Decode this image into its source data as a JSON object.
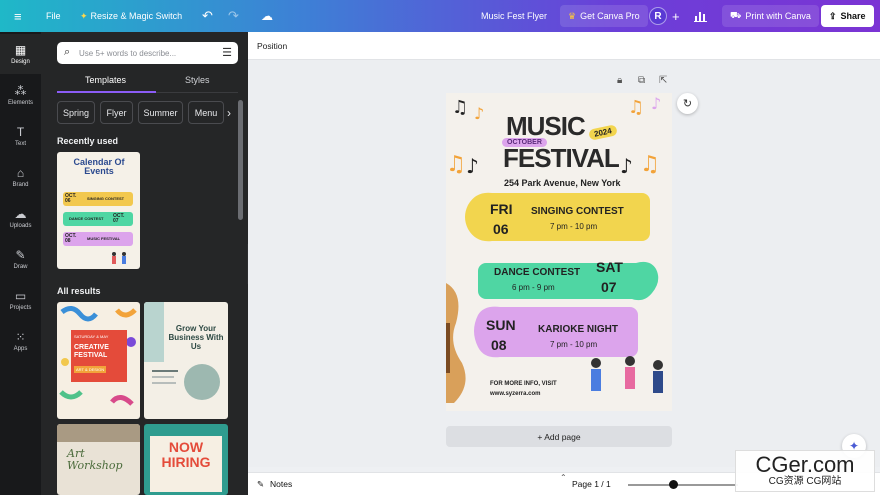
{
  "topbar": {
    "menu_icon": "hamburger-icon",
    "file_label": "File",
    "resize_label": "Resize & Magic Switch",
    "doc_title": "Music Fest Flyer",
    "get_pro_label": "Get Canva Pro",
    "avatar_letter": "R",
    "print_label": "Print with Canva",
    "share_label": "Share"
  },
  "rail": {
    "items": [
      {
        "label": "Design",
        "icon": "design-icon"
      },
      {
        "label": "Elements",
        "icon": "elements-icon"
      },
      {
        "label": "Text",
        "icon": "text-icon"
      },
      {
        "label": "Brand",
        "icon": "brand-icon"
      },
      {
        "label": "Uploads",
        "icon": "uploads-icon"
      },
      {
        "label": "Draw",
        "icon": "draw-icon"
      },
      {
        "label": "Projects",
        "icon": "projects-icon"
      },
      {
        "label": "Apps",
        "icon": "apps-icon"
      }
    ]
  },
  "panel": {
    "search_placeholder": "Use 5+ words to describe...",
    "tab_templates": "Templates",
    "tab_styles": "Styles",
    "chips": [
      "Spring",
      "Flyer",
      "Summer",
      "Menu"
    ],
    "recently_used": "Recently used",
    "all_results": "All results",
    "thumbs": {
      "calendar_title": "Calendar Of Events",
      "cal_row1": "OCT. 06",
      "cal_row1_text": "SINGING CONTEST",
      "cal_row2_text": "DANCE CONTEST",
      "cal_row2": "OCT. 07",
      "cal_row3": "OCT. 08",
      "cal_row3_text": "MUSIC FESTIVAL",
      "creative_date": "SATURDAY & MAY",
      "creative_title": "CREATIVE FESTIVAL",
      "creative_sub": "ART & DESIGN",
      "grow_title": "Grow Your Business With Us",
      "art_title": "Art Workshop",
      "hiring_title": "NOW HIRING"
    }
  },
  "toolbar": {
    "position_label": "Position"
  },
  "flyer": {
    "title_line1": "MUSIC",
    "badge_year": "2024",
    "badge_month": "OCTOBER",
    "title_line2": "FESTIVAL",
    "address": "254 Park Avenue, New York",
    "events": [
      {
        "day": "FRI",
        "date": "06",
        "name": "SINGING CONTEST",
        "time": "7 pm - 10 pm",
        "color": "#f2d54e"
      },
      {
        "day": "SAT",
        "date": "07",
        "name": "DANCE CONTEST",
        "time": "6 pm - 9 pm",
        "color": "#4fd6a3"
      },
      {
        "day": "SUN",
        "date": "08",
        "name": "KARIOKE NIGHT",
        "time": "7 pm - 10 pm",
        "color": "#dca4ec"
      }
    ],
    "info": "FOR MORE INFO, VISIT",
    "site": "www.syzerra.com"
  },
  "canvas": {
    "add_page_label": "+ Add page"
  },
  "bottombar": {
    "notes_label": "Notes",
    "page_label": "Page 1 / 1"
  },
  "watermark": {
    "line1": "CGer.com",
    "line2": "CG资源 CG网站"
  },
  "colors": {
    "accent": "#8b5cf6",
    "panel_bg": "#252627",
    "rail_bg": "#18191b"
  }
}
